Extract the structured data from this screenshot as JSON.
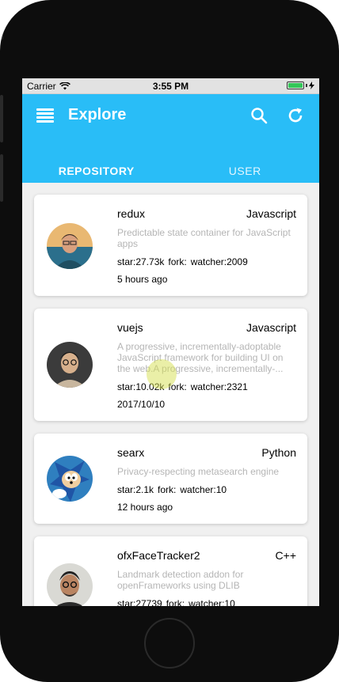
{
  "status_bar": {
    "carrier": "Carrier",
    "time": "3:55 PM"
  },
  "app_bar": {
    "title": "Explore"
  },
  "tabs": [
    {
      "label": "REPOSITORY"
    },
    {
      "label": "USER"
    }
  ],
  "repos": [
    {
      "name": "redux",
      "language": "Javascript",
      "description": "Predictable state container for JavaScript apps",
      "star": "star:27.73k",
      "fork": "fork:",
      "watcher": "watcher:2009",
      "time": "5 hours ago"
    },
    {
      "name": "vuejs",
      "language": "Javascript",
      "description": "A progressive, incrementally-adoptable JavaScript framework for building UI on the web.A progressive, incrementally-...",
      "star": "star:10.02k",
      "fork": "fork:",
      "watcher": "watcher:2321",
      "time": "2017/10/10"
    },
    {
      "name": "searx",
      "language": "Python",
      "description": "Privacy-respecting metasearch engine",
      "star": "star:2.1k",
      "fork": "fork:",
      "watcher": "watcher:10",
      "time": "12 hours ago"
    },
    {
      "name": "ofxFaceTracker2",
      "language": "C++",
      "description": "Landmark detection addon for openFrameworks using DLIB",
      "star": "star:27739",
      "fork": "fork:",
      "watcher": "watcher:10",
      "time": ""
    }
  ]
}
